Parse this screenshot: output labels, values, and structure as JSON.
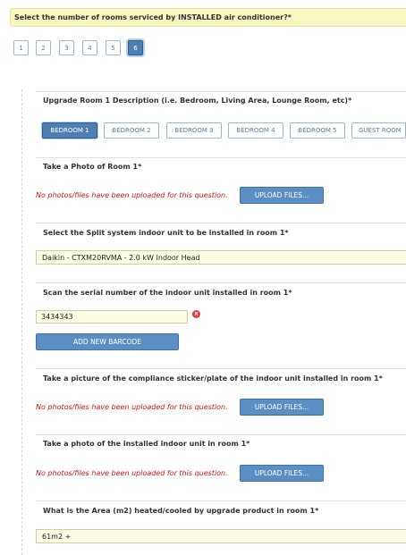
{
  "top_question": "Select the number of rooms serviced by INSTALLED air conditioner?*",
  "room_count_options": [
    "1",
    "2",
    "3",
    "4",
    "5",
    "6"
  ],
  "room_count_selected": "6",
  "q_room_description": "Upgrade Room 1 Description (i.e. Bedroom, Living Area, Lounge Room, etc)*",
  "room_tabs": [
    "BEDROOM 1",
    "BEDROOM 2",
    "BEDROOM 3",
    "BEDROOM 4",
    "BEDROOM 5",
    "GUEST ROOM"
  ],
  "room_tab_selected": "BEDROOM 1",
  "q_photo_room": "Take a Photo of Room 1*",
  "no_photos_text": "No photos/files have been uploaded for this question.",
  "upload_label": "UPLOAD FILES...",
  "q_indoor_unit": "Select the Split system indoor unit to be installed in room 1*",
  "indoor_unit_value": "Daikin - CTXM20RVMA - 2.0 kW Indoor Head",
  "q_serial": "Scan the serial number of the indoor unit installed in room 1*",
  "serial_value": "3434343",
  "add_barcode_label": "ADD NEW BARCODE",
  "q_compliance": "Take a picture of the compliance sticker/plate of the indoor unit installed in room 1*",
  "q_photo_indoor": "Take a photo of the installed indoor unit in room 1*",
  "q_area": "What is the Area (m2) heated/cooled by upgrade product in room 1*",
  "area_value": "61m2 +",
  "colors": {
    "accent": "#4e7fb0",
    "button": "#5b8fc4",
    "error_text": "#d01818",
    "highlight_bg": "#f7f7c2"
  }
}
